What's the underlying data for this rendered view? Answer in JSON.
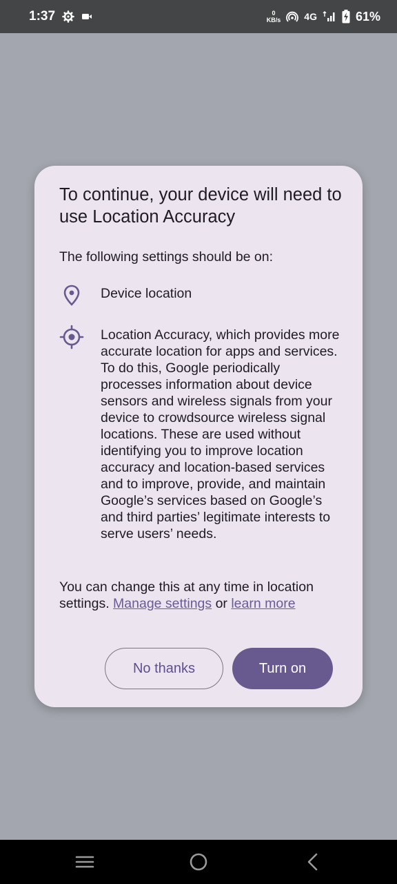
{
  "status_bar": {
    "time": "1:37",
    "data_rate_value": "0",
    "data_rate_unit": "KB/s",
    "network_type": "4G",
    "battery_percent": "61%"
  },
  "dialog": {
    "title": "To continue, your device will need to use Location Accuracy",
    "subtitle": "The following settings should be on:",
    "settings": [
      {
        "icon": "location-pin-icon",
        "label": "Device location"
      },
      {
        "icon": "gps-target-icon",
        "label": "Location Accuracy, which provides more accurate location for apps and services. To do this, Google periodically processes information about device sensors and wireless signals from your device to crowdsource wireless signal locations. These are used without identifying you to improve location accuracy and location-based services and to improve, provide, and maintain Google’s services based on Google’s and third parties’ legitimate interests to serve users’ needs."
      }
    ],
    "footer_prefix": "You can change this at any time in location settings.",
    "manage_settings_link": "Manage settings",
    "footer_or": "or",
    "learn_more_link": "learn more",
    "secondary_button": "No thanks",
    "primary_button": "Turn on"
  },
  "nav_bar": {
    "icons": [
      "recent-apps-icon",
      "home-icon",
      "back-icon"
    ]
  },
  "colors": {
    "accent": "#685a8f",
    "dialog_bg": "#ece5f0",
    "scrim": "#a3a6ae"
  }
}
